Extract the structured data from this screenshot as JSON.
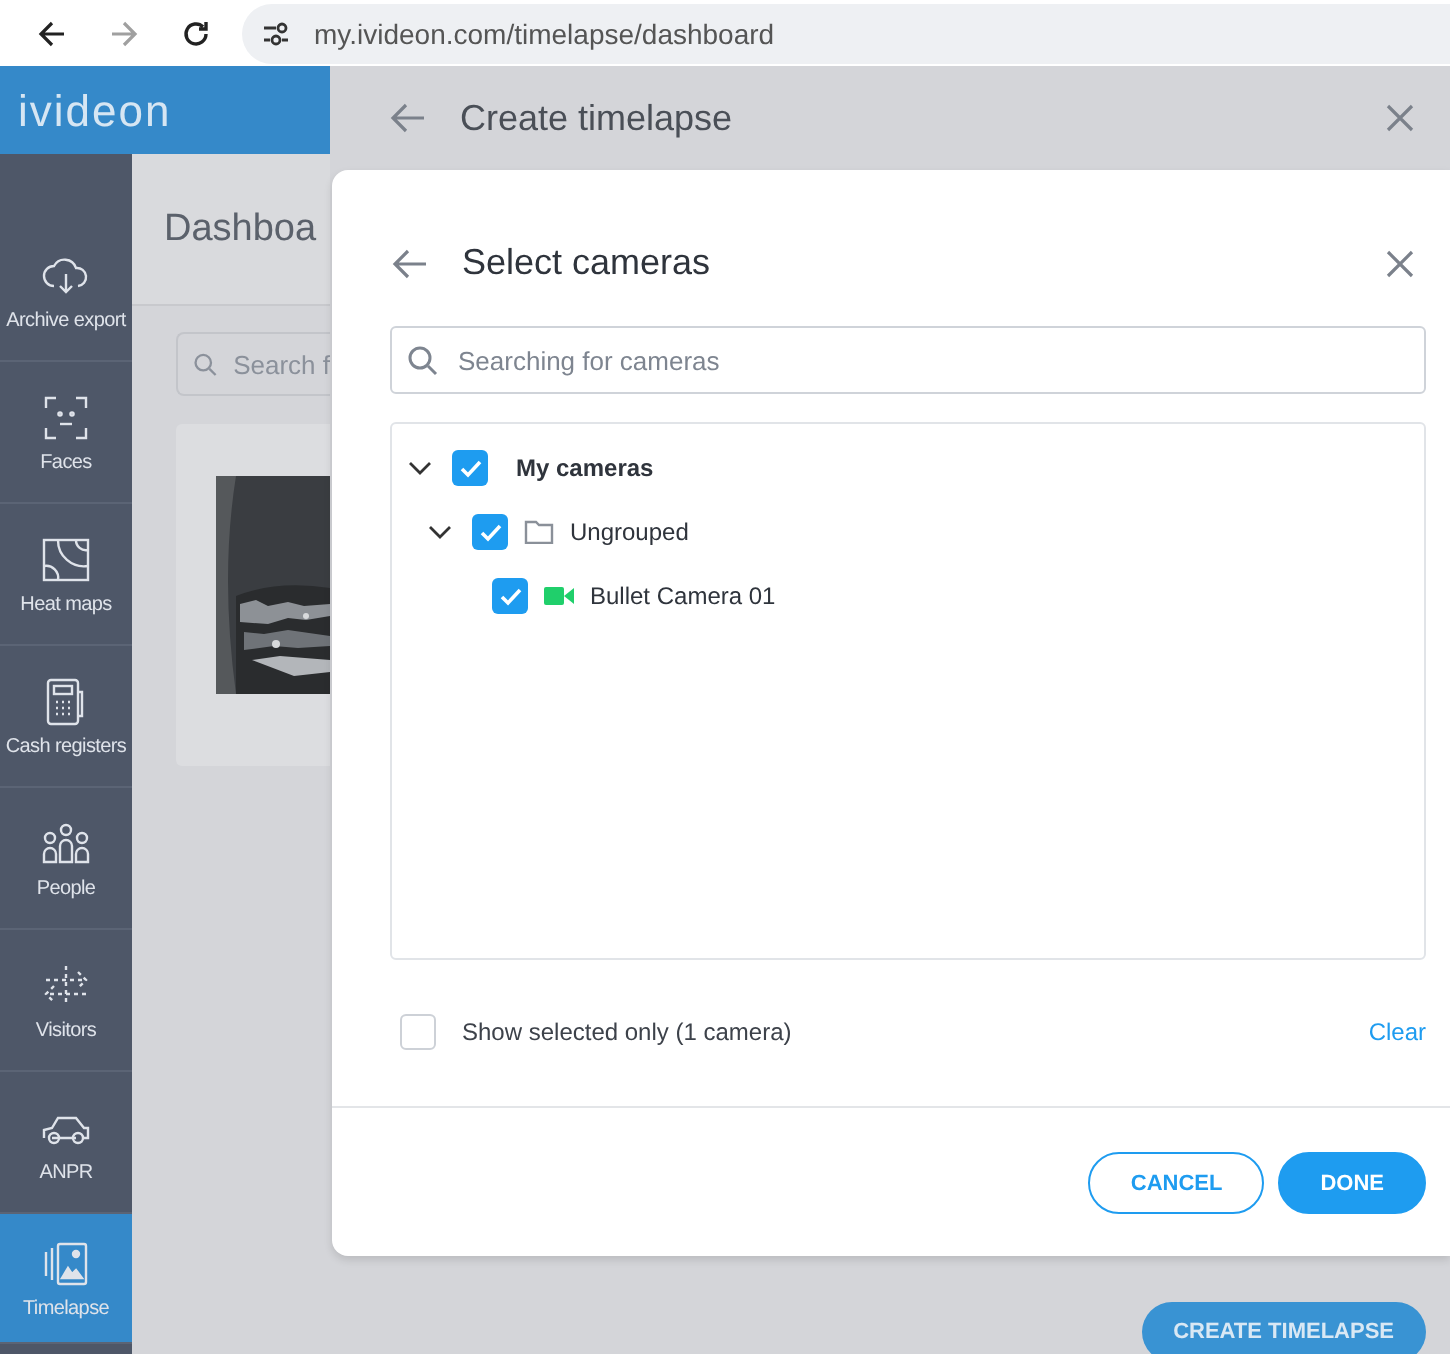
{
  "browser": {
    "url": "my.ivideon.com/timelapse/dashboard",
    "back_disabled": false,
    "forward_disabled": true
  },
  "logo": "ivideon",
  "sidebar": {
    "items": [
      {
        "label": "Archive export",
        "selected": false
      },
      {
        "label": "Faces",
        "selected": false
      },
      {
        "label": "Heat maps",
        "selected": false
      },
      {
        "label": "Cash registers",
        "selected": false
      },
      {
        "label": "People",
        "selected": false
      },
      {
        "label": "Visitors",
        "selected": false
      },
      {
        "label": "ANPR",
        "selected": false
      },
      {
        "label": "Timelapse",
        "selected": true
      }
    ]
  },
  "dashboard": {
    "title": "Dashboa",
    "search": {
      "placeholder": "Search f"
    }
  },
  "panel": {
    "title": "Create timelapse",
    "create_button": "CREATE TIMELAPSE"
  },
  "dialog": {
    "title": "Select cameras",
    "search": {
      "placeholder": "Searching for cameras"
    },
    "tree": [
      {
        "label": "My cameras",
        "kind": "root",
        "checked": true,
        "expanded": true,
        "children": [
          {
            "label": "Ungrouped",
            "kind": "folder",
            "checked": true,
            "expanded": true,
            "children": [
              {
                "label": "Bullet Camera 01",
                "kind": "camera",
                "checked": true
              }
            ]
          }
        ]
      }
    ],
    "show_selected": {
      "label": "Show selected only (1 camera)",
      "checked": false
    },
    "clear": "Clear",
    "buttons": [
      {
        "label": "CANCEL",
        "kind": "outline"
      },
      {
        "label": "DONE",
        "kind": "primary"
      }
    ]
  }
}
